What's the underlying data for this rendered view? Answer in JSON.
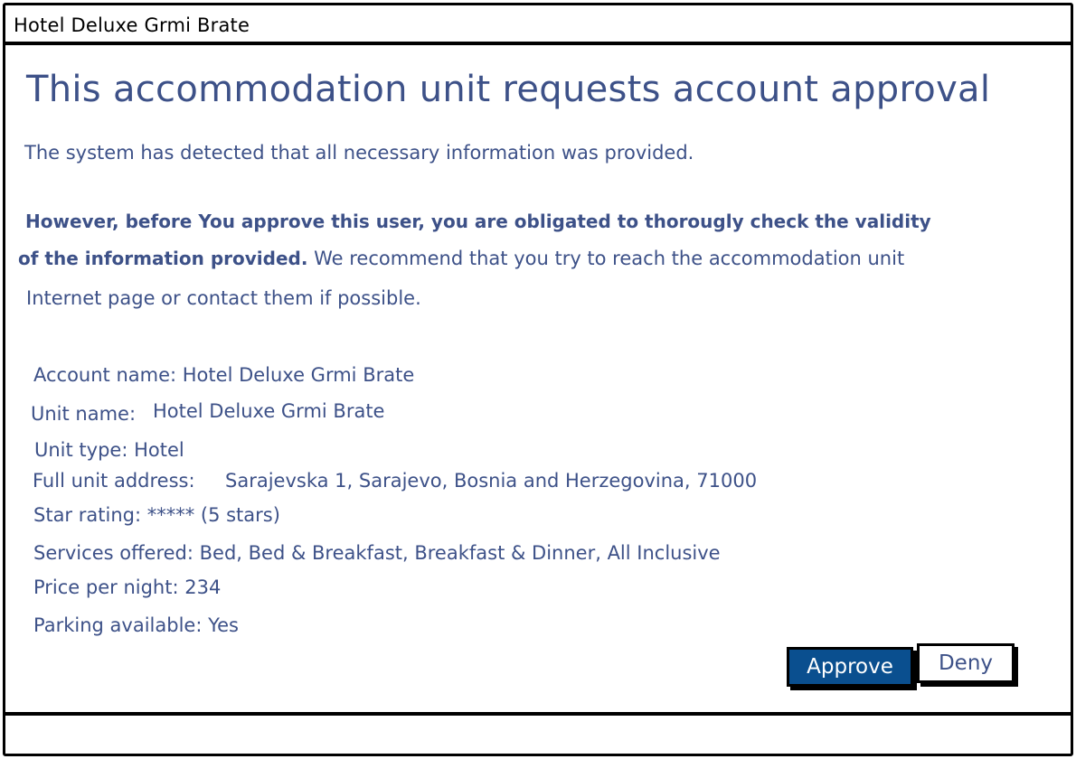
{
  "window": {
    "title": "Hotel Deluxe Grmi Brate"
  },
  "main": {
    "heading": "This accommodation unit requests account approval",
    "detected_text": "The system has detected that all necessary information was provided.",
    "warning_bold_line1": "However, before You approve this user, you are obligated to thorougly check the validity",
    "warning_bold_line2": "of the information provided.",
    "warning_rest_line2": " We recommend that you try to reach the accommodation unit",
    "warning_line3": "Internet page or contact them if possible."
  },
  "details": {
    "account_name": "Account name: Hotel Deluxe Grmi Brate",
    "unit_name_label": "Unit name:",
    "unit_name_value": "Hotel Deluxe Grmi Brate",
    "unit_type": "Unit type: Hotel",
    "address_label": "Full unit address:",
    "address_value": "Sarajevska 1, Sarajevo, Bosnia and Herzegovina, 71000",
    "star_rating": "Star rating: ***** (5 stars)",
    "services": "Services offered: Bed, Bed & Breakfast, Breakfast & Dinner, All Inclusive",
    "price": "Price per night: 234",
    "parking": "Parking available: Yes"
  },
  "actions": {
    "approve_label": "Approve",
    "deny_label": "Deny"
  },
  "colors": {
    "text": "#3d5188",
    "approve_bg": "#0a4f8f"
  }
}
